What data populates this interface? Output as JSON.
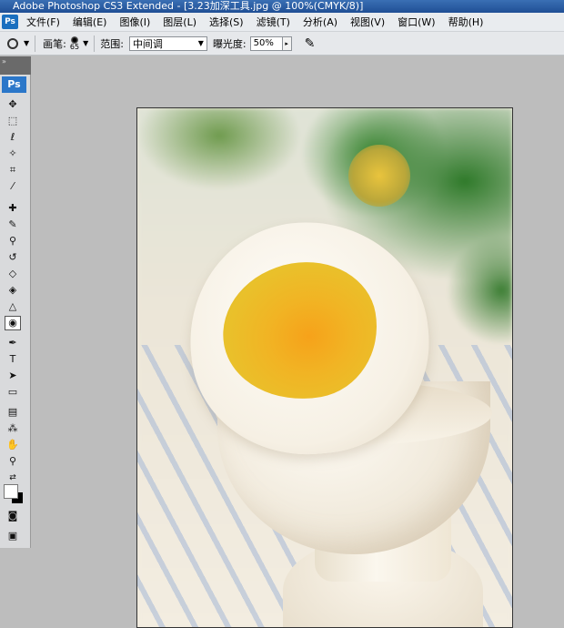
{
  "window": {
    "title": "Adobe Photoshop CS3 Extended - [3.23加深工具.jpg @ 100%(CMYK/8)]"
  },
  "menu": {
    "app_icon": "Ps",
    "items": [
      {
        "label": "文件(F)"
      },
      {
        "label": "编辑(E)"
      },
      {
        "label": "图像(I)"
      },
      {
        "label": "图层(L)"
      },
      {
        "label": "选择(S)"
      },
      {
        "label": "滤镜(T)"
      },
      {
        "label": "分析(A)"
      },
      {
        "label": "视图(V)"
      },
      {
        "label": "窗口(W)"
      },
      {
        "label": "帮助(H)"
      }
    ]
  },
  "options": {
    "brush_label": "画笔:",
    "brush_size": "65",
    "range_label": "范围:",
    "range_value": "中间调",
    "exposure_label": "曝光度:",
    "exposure_value": "50%"
  },
  "toolbox": {
    "logo": "Ps",
    "active_tool": "burn-tool",
    "foreground_color": "#ffffff",
    "background_color": "#000000"
  }
}
